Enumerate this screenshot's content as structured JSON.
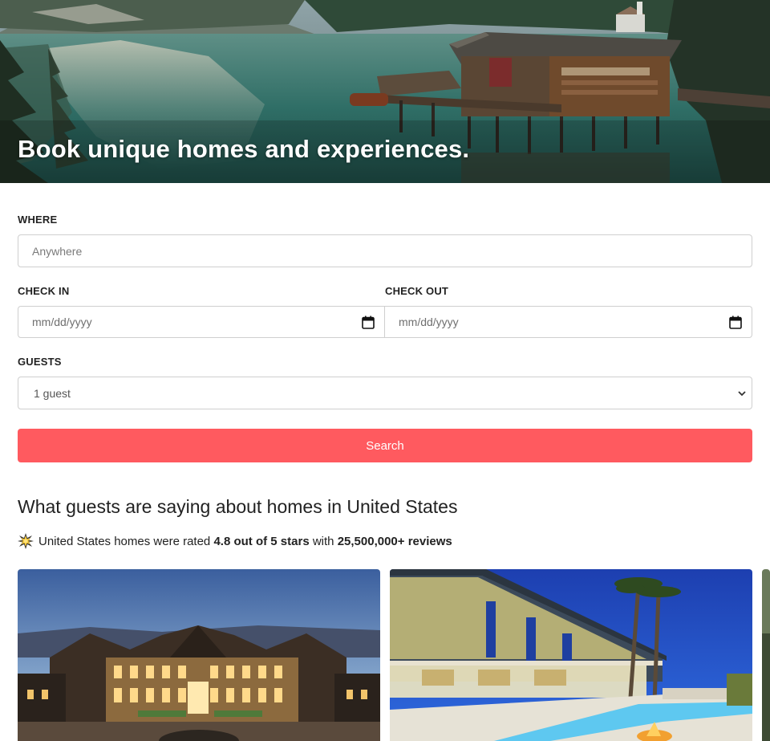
{
  "hero": {
    "title": "Book unique homes and experiences."
  },
  "search_form": {
    "where": {
      "label": "WHERE",
      "placeholder": "Anywhere"
    },
    "check_in": {
      "label": "CHECK IN",
      "placeholder": "mm/dd/yyyy"
    },
    "check_out": {
      "label": "CHECK OUT",
      "placeholder": "mm/dd/yyyy"
    },
    "guests": {
      "label": "GUESTS",
      "selected": "1 guest"
    },
    "search_button": "Search",
    "accent_color": "#ff5a5f"
  },
  "reviews": {
    "heading": "What guests are saying about homes in United States",
    "rating_prefix": "United States homes were rated",
    "rating_value": "4.8 out of 5 stars",
    "rating_middle": "with",
    "review_count": "25,500,000+ reviews",
    "icon": "star-burst-icon"
  },
  "listings": [
    {
      "image": "mansion-at-dusk"
    },
    {
      "image": "modern-villa-with-pool"
    },
    {
      "image": "partial-card"
    }
  ]
}
